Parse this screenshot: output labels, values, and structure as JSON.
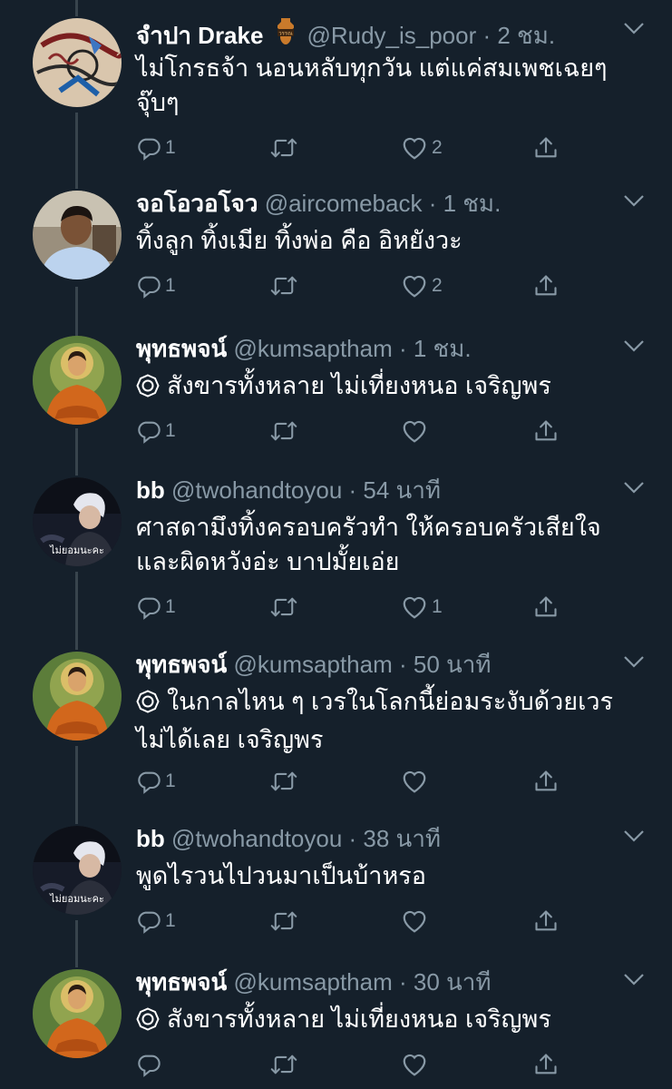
{
  "tweets": [
    {
      "name": "จำปา Drake",
      "has_badge": true,
      "handle": "@Rudy_is_poor",
      "time": "2 ชม.",
      "lines": [
        "ไม่โกรธจ้า นอนหลับทุกวัน แต่แค่สมเพชเฉยๆ",
        "จุ๊บๆ"
      ],
      "gear": false,
      "reply_count": "1",
      "like_count": "2",
      "avatar": "illustration-avatar"
    },
    {
      "name": "จอโอวอโจว",
      "has_badge": false,
      "handle": "@aircomeback",
      "time": "1 ชม.",
      "lines": [
        "ทิ้งลูก ทิ้งเมีย ทิ้งพ่อ คือ อิหยังวะ"
      ],
      "gear": false,
      "reply_count": "1",
      "like_count": "2",
      "avatar": "man-photo-avatar"
    },
    {
      "name": "พุทธพจน์",
      "has_badge": false,
      "handle": "@kumsaptham",
      "time": "1 ชม.",
      "lines": [
        "สังขารทั้งหลาย ไม่เที่ยงหนอ เจริญพร"
      ],
      "gear": true,
      "reply_count": "1",
      "like_count": "",
      "avatar": "buddha-avatar"
    },
    {
      "name": "bb",
      "has_badge": false,
      "handle": "@twohandtoyou",
      "time": "54 นาที",
      "lines": [
        "ศาสดามึงทิ้งครอบครัวทำ ให้ครอบครัวเสียใจ",
        "และผิดหวังอ่ะ บาปมั้ยเอ่ย"
      ],
      "gear": false,
      "reply_count": "1",
      "like_count": "1",
      "avatar": "bb-avatar"
    },
    {
      "name": "พุทธพจน์",
      "has_badge": false,
      "handle": "@kumsaptham",
      "time": "50 นาที",
      "lines": [
        "ในกาลไหน ๆ เวรในโลกนี้ย่อมระงับด้วยเวร",
        "ไม่ได้เลย เจริญพร"
      ],
      "gear": true,
      "reply_count": "1",
      "like_count": "",
      "avatar": "buddha-avatar"
    },
    {
      "name": "bb",
      "has_badge": false,
      "handle": "@twohandtoyou",
      "time": "38 นาที",
      "lines": [
        "พูดไรวนไปวนมาเป็นบ้าหรอ"
      ],
      "gear": false,
      "reply_count": "1",
      "like_count": "",
      "avatar": "bb-avatar"
    },
    {
      "name": "พุทธพจน์",
      "has_badge": false,
      "handle": "@kumsaptham",
      "time": "30 นาที",
      "lines": [
        "สังขารทั้งหลาย ไม่เที่ยงหนอ เจริญพร"
      ],
      "gear": true,
      "reply_count": "",
      "like_count": "",
      "avatar": "buddha-avatar"
    }
  ],
  "avatar_overlay_text": "ไม่ยอมนะคะ",
  "badge_text": "วรรณ",
  "colors": {
    "background": "#15202b",
    "secondary_text": "#8899a6",
    "thread_line": "#38444d",
    "primary_text": "#ffffff"
  },
  "icons": {
    "reply": "reply-icon",
    "retweet": "retweet-icon",
    "like": "heart-icon",
    "share": "share-icon",
    "caret": "chevron-down-icon",
    "gear": "dharma-wheel-icon",
    "badge": "vase-badge-icon"
  }
}
